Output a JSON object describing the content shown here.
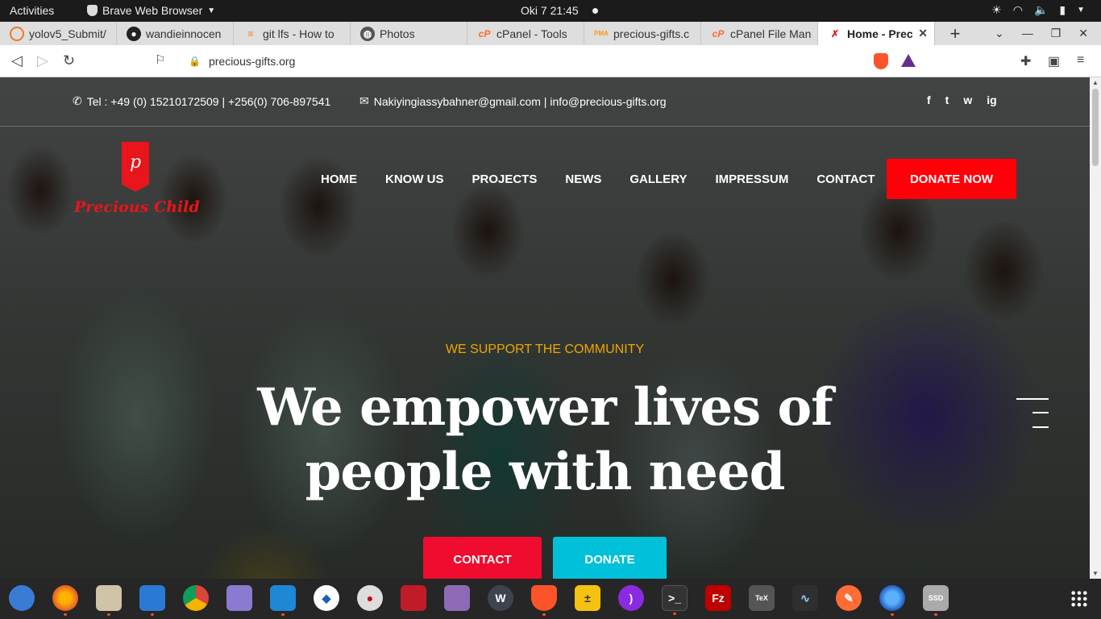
{
  "topbar": {
    "activities": "Activities",
    "app_name": "Brave Web Browser",
    "clock": "Oki 7  21:45"
  },
  "tabs": [
    {
      "label": "yolov5_Submit/",
      "icon": "jupyter-icon",
      "color": "#f37726"
    },
    {
      "label": "wandieinnocen",
      "icon": "github-icon",
      "color": "#222222"
    },
    {
      "label": "git lfs - How to",
      "icon": "stackoverflow-icon",
      "color": "#f48024"
    },
    {
      "label": "Photos",
      "icon": "globe-icon",
      "color": "#555555"
    },
    {
      "label": "cPanel - Tools",
      "icon": "cpanel-icon",
      "color": "#ff6c2c"
    },
    {
      "label": "precious-gifts.c",
      "icon": "phpmyadmin-icon",
      "color": "#f89c0e"
    },
    {
      "label": "cPanel File Man",
      "icon": "cpanel-icon",
      "color": "#ff6c2c"
    },
    {
      "label": "Home - Prec",
      "icon": "site-icon",
      "color": "#e8151b",
      "active": true
    }
  ],
  "address_bar": {
    "url": "precious-gifts.org"
  },
  "site": {
    "contact": {
      "tel": "Tel : +49 (0) 15210172509 | +256(0) 706-897541",
      "email": "Nakiyingiassybahner@gmail.com | info@precious-gifts.org"
    },
    "socials": [
      "f",
      "t",
      "w",
      "ig"
    ],
    "logo_text": "Precious Child",
    "logo_letter": "p",
    "nav": [
      "HOME",
      "KNOW US",
      "PROJECTS",
      "NEWS",
      "GALLERY",
      "IMPRESSUM",
      "CONTACT"
    ],
    "donate_now": "DONATE NOW",
    "tagline": "WE SUPPORT THE COMMUNITY",
    "hero_line1": "We empower lives of",
    "hero_line2": "people with need",
    "cta_contact": "CONTACT",
    "cta_donate": "DONATE",
    "colors": {
      "accent_red": "#ff0008",
      "accent_cyan": "#00c1d9",
      "tagline_gold": "#f0a500"
    }
  },
  "dock": [
    "thunderbird-icon",
    "firefox-icon",
    "files-icon",
    "writer-icon",
    "chrome-icon",
    "save-icon",
    "vscode-icon",
    "inkscape-icon",
    "vpn-icon",
    "screen-recorder-icon",
    "video-editor-icon",
    "wireshark-icon",
    "brave-icon",
    "calculator-icon",
    "podcast-icon",
    "terminal-icon",
    "filezilla-icon",
    "texmaker-icon",
    "system-monitor-icon",
    "postman-icon",
    "firefox-dev-icon",
    "ssd-icon"
  ]
}
